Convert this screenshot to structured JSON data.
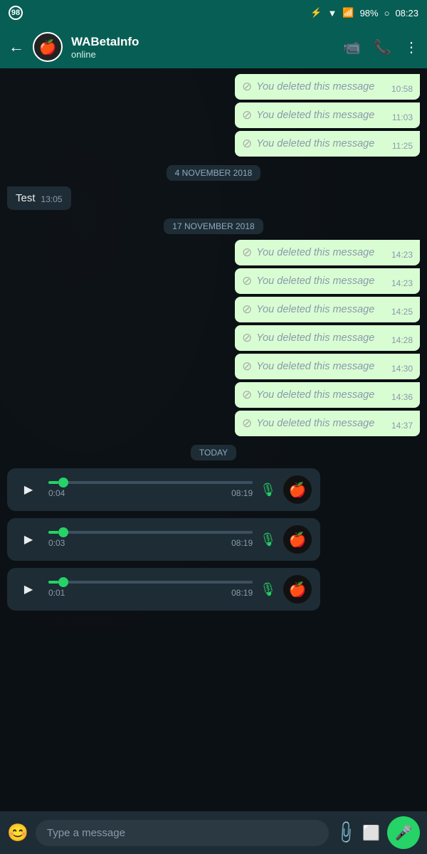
{
  "statusBar": {
    "badge": "98",
    "battery": "98%",
    "time": "08:23"
  },
  "header": {
    "contactName": "WABetaInfo",
    "status": "online",
    "avatarIcon": "🍎",
    "backIcon": "←",
    "videoIcon": "📹",
    "callIcon": "📞",
    "menuIcon": "⋮"
  },
  "messages": [
    {
      "type": "deleted",
      "text": "You deleted this message",
      "time": "10:58"
    },
    {
      "type": "deleted",
      "text": "You deleted this message",
      "time": "11:03"
    },
    {
      "type": "deleted",
      "text": "You deleted this message",
      "time": "11:25"
    },
    {
      "type": "date",
      "label": "4 NOVEMBER 2018"
    },
    {
      "type": "sent",
      "text": "Test",
      "time": "13:05"
    },
    {
      "type": "date",
      "label": "17 NOVEMBER 2018"
    },
    {
      "type": "deleted",
      "text": "You deleted this message",
      "time": "14:23"
    },
    {
      "type": "deleted",
      "text": "You deleted this message",
      "time": "14:23"
    },
    {
      "type": "deleted",
      "text": "You deleted this message",
      "time": "14:25"
    },
    {
      "type": "deleted",
      "text": "You deleted this message",
      "time": "14:28"
    },
    {
      "type": "deleted",
      "text": "You deleted this message",
      "time": "14:30"
    },
    {
      "type": "deleted",
      "text": "You deleted this message",
      "time": "14:36"
    },
    {
      "type": "deleted",
      "text": "You deleted this message",
      "time": "14:37"
    },
    {
      "type": "date",
      "label": "TODAY"
    },
    {
      "type": "voice",
      "duration": "0:04",
      "time": "08:19",
      "progress": 5
    },
    {
      "type": "voice",
      "duration": "0:03",
      "time": "08:19",
      "progress": 5
    },
    {
      "type": "voice",
      "duration": "0:01",
      "time": "08:19",
      "progress": 5
    }
  ],
  "inputBar": {
    "placeholder": "Type a message",
    "emojiIcon": "😊",
    "micIcon": "🎤"
  }
}
